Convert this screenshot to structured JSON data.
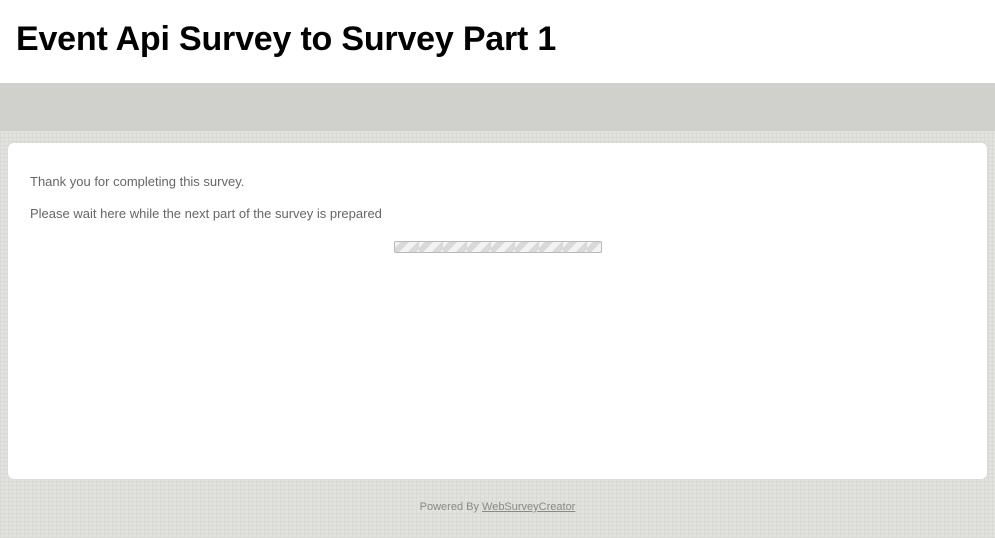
{
  "header": {
    "title": "Event Api Survey to Survey Part 1"
  },
  "content": {
    "thank_you": "Thank you for completing this survey.",
    "wait_message": "Please wait here while the next part of the survey is prepared"
  },
  "footer": {
    "prefix": "Powered By  ",
    "link_text": "WebSurveyCreator"
  }
}
